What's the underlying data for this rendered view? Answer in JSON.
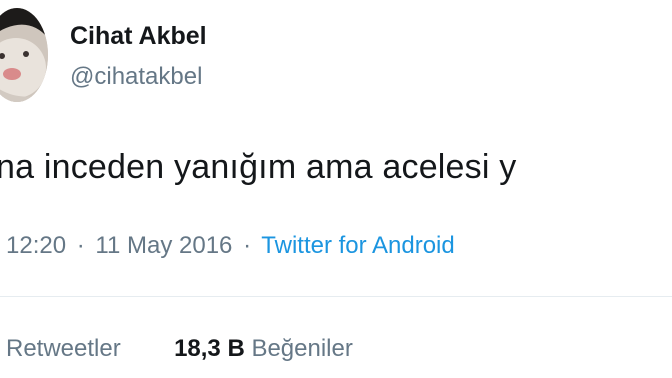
{
  "user": {
    "display_name": "Cihat Akbel",
    "handle": "@cihatakbel"
  },
  "tweet": {
    "text": "na inceden yanığım ama acelesi y",
    "time": "12:20",
    "separator": "·",
    "date": "11 May 2016",
    "source": "Twitter for Android"
  },
  "stats": {
    "retweets_label": "Retweetler",
    "likes_count": "18,3 B",
    "likes_label": "Beğeniler"
  },
  "colors": {
    "text": "#14171a",
    "secondary": "#657786",
    "link": "#1b95e0",
    "divider": "#e6ecf0"
  }
}
